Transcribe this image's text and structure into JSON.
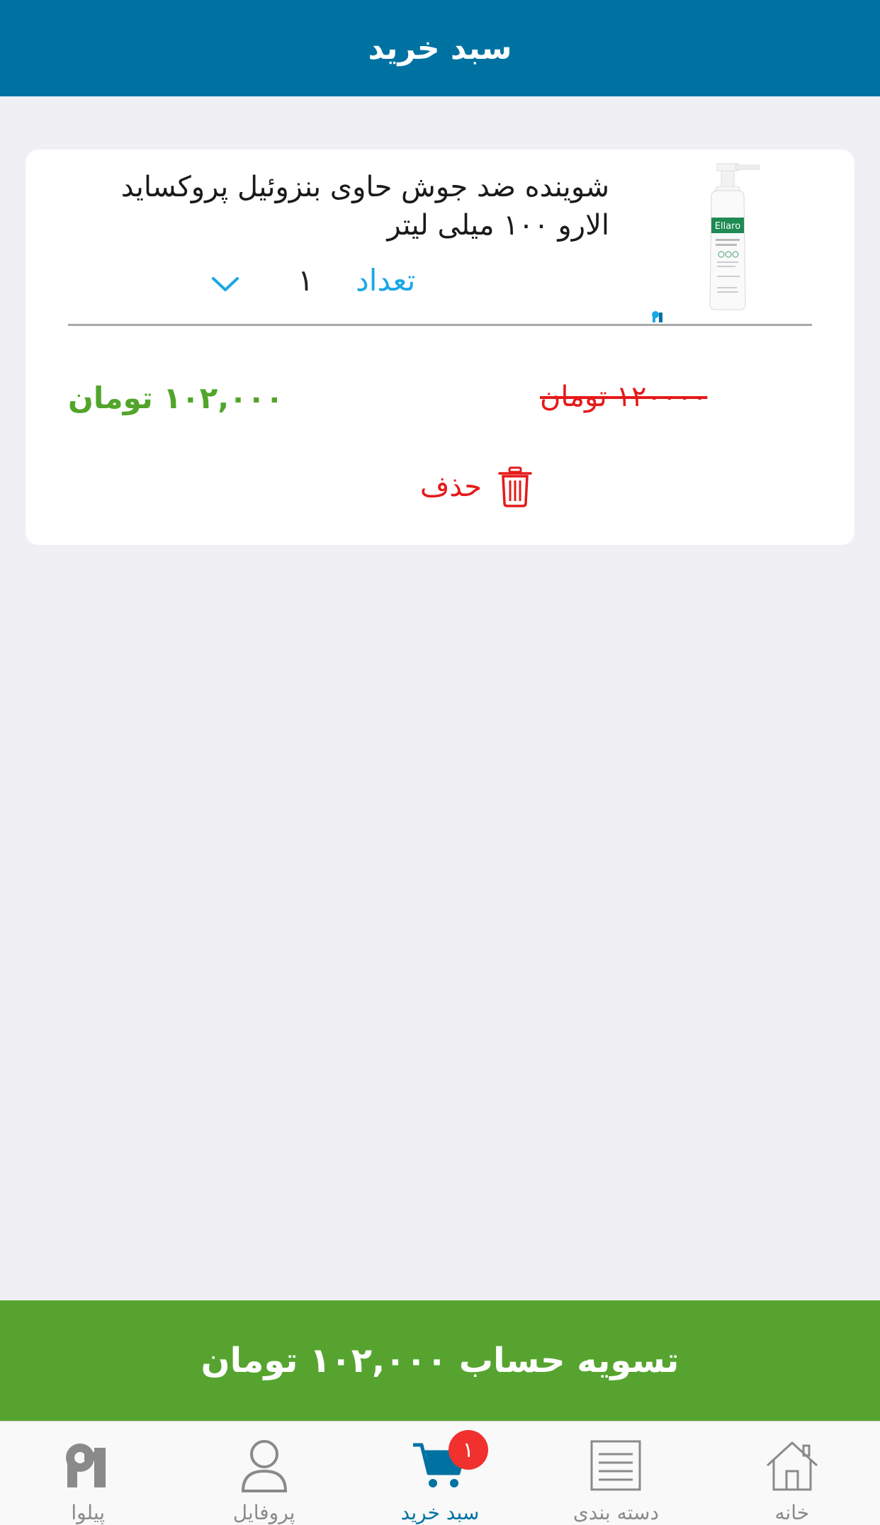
{
  "header": {
    "title": "سبد خرید"
  },
  "cart_item": {
    "title": "شوینده ضد جوش حاوی بنزوئیل پروکساید الارو ۱۰۰ میلی لیتر",
    "quantity_label": "تعداد",
    "quantity_value": "۱",
    "image_brand_text": "Ellaro",
    "old_price": "۱۲۰۰۰۰ تومان",
    "new_price": "۱۰۲,۰۰۰ تومان",
    "delete_label": "حذف"
  },
  "checkout": {
    "label": "تسویه حساب ۱۰۲,۰۰۰ تومان"
  },
  "tabbar": {
    "items": [
      {
        "label": "پیلوا",
        "icon": "pilva-logo-icon"
      },
      {
        "label": "پروفایل",
        "icon": "user-icon"
      },
      {
        "label": "سبد خرید",
        "icon": "cart-icon",
        "badge": "۱",
        "active": true
      },
      {
        "label": "دسته بندی",
        "icon": "list-icon"
      },
      {
        "label": "خانه",
        "icon": "home-icon"
      }
    ]
  },
  "colors": {
    "header": "#0072a2",
    "checkout": "#56a42f",
    "price_new": "#52a52b",
    "price_old": "#e51a1a",
    "accent": "#1ba7e6",
    "badge": "#f0312e"
  }
}
